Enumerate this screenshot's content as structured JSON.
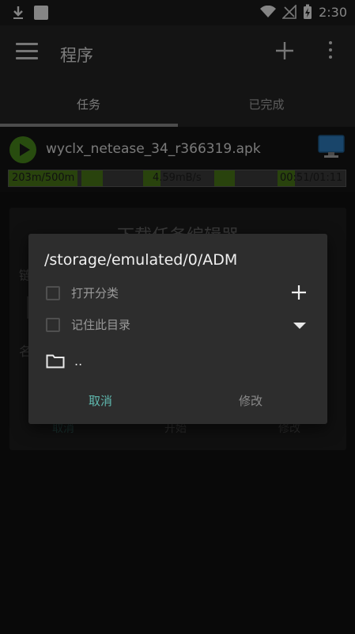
{
  "status_bar": {
    "time": "2:30",
    "icons": [
      "download-notification-icon",
      "square-notification-icon",
      "wifi-icon",
      "no-signal-icon",
      "battery-charging-icon"
    ]
  },
  "toolbar": {
    "title": "程序",
    "menu_icon": "hamburger-menu-icon",
    "add_icon": "plus-icon",
    "more_icon": "more-vertical-icon"
  },
  "tabs": [
    {
      "label": "任务",
      "active": true
    },
    {
      "label": "已完成",
      "active": false
    }
  ],
  "download": {
    "file_name": "wyclx_netease_34_r366319.apk",
    "progress_text": "203m/500m",
    "progress_fraction": 0.406,
    "speed": "4.59mB/s",
    "time": "00:51/01:11",
    "play_icon": "play-icon",
    "monitor_icon": "monitor-icon",
    "accent": "#4c7a18"
  },
  "background_dialog": {
    "title": "下载任务编辑器",
    "left_label_1": "链",
    "left_label_2": "名",
    "right_mark_1": "⁝",
    "right_mark_2": "⁝",
    "buttons": {
      "cancel": "取消",
      "start": "开始",
      "modify": "修改"
    }
  },
  "folder_dialog": {
    "path": "/storage/emulated/0/ADM",
    "option_1": "打开分类",
    "option_2": "记住此目录",
    "folder_entry": "..",
    "cancel": "取消",
    "modify": "修改",
    "accent": "#5fb8ae"
  }
}
